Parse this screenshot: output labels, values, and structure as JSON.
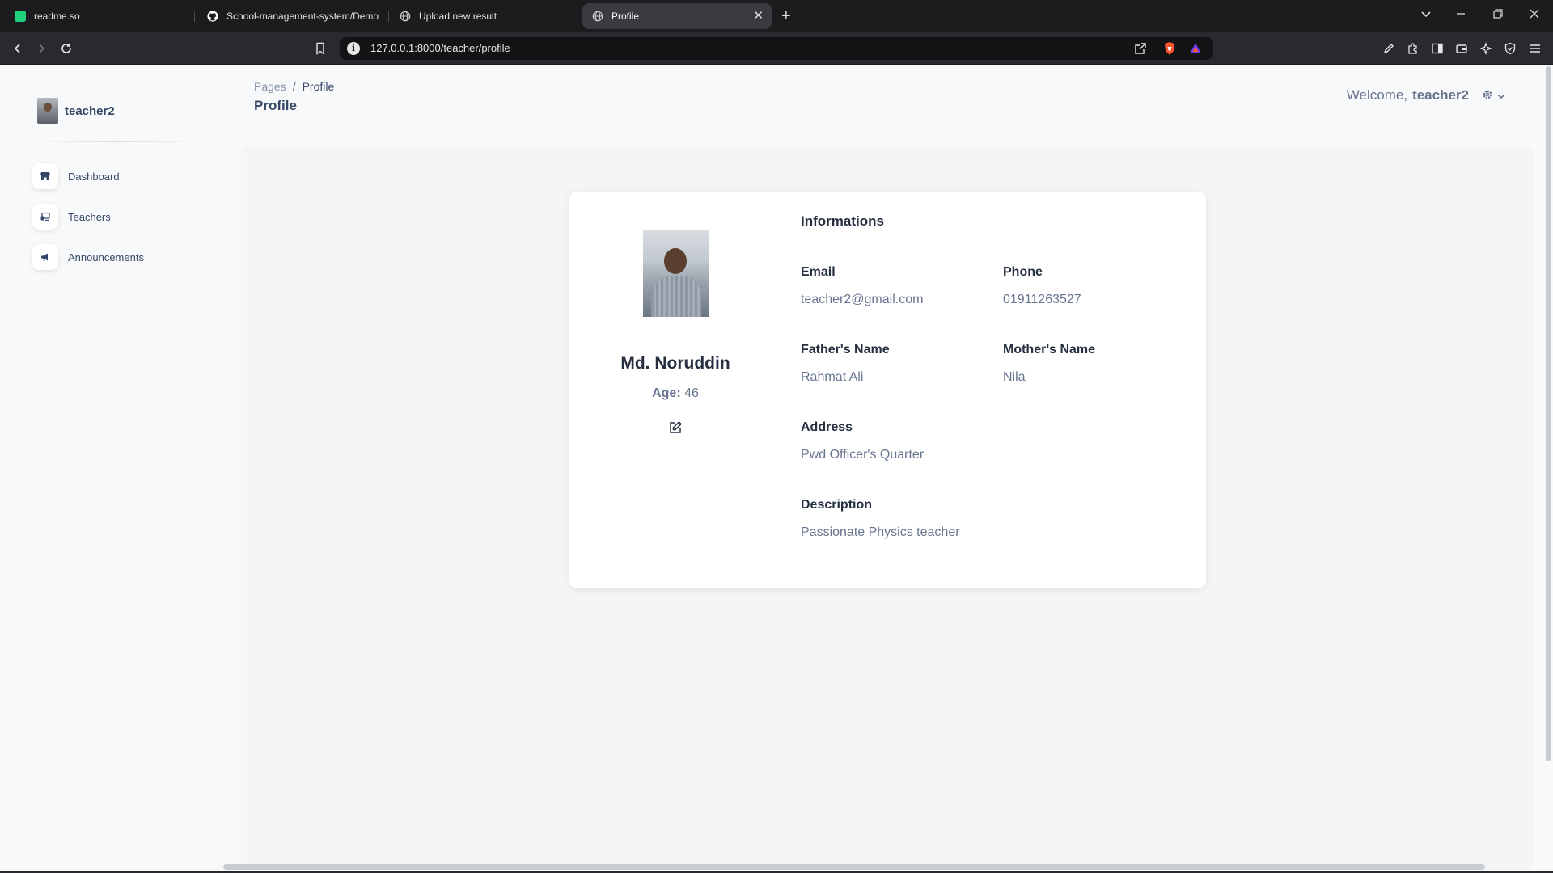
{
  "browser": {
    "tabs": [
      {
        "title": "readme.so",
        "favicon_color": "#1fd17c"
      },
      {
        "title": "School-management-system/Demo",
        "favicon_color": "#ffffff"
      },
      {
        "title": "Upload new result",
        "favicon_color": "#cccccc"
      },
      {
        "title": "Profile",
        "favicon_color": "#cccccc",
        "active": true
      }
    ],
    "url": "127.0.0.1:8000/teacher/profile",
    "icons": [
      "back-icon",
      "forward-icon",
      "reload-icon",
      "bookmark-icon",
      "site-info-icon",
      "share-icon",
      "brave-shield-icon",
      "brave-rewards-icon",
      "pen-icon",
      "extensions-icon",
      "sidebar-icon",
      "wallet-icon",
      "leo-icon",
      "vpn-icon",
      "menu-icon"
    ]
  },
  "sidebar": {
    "user": "teacher2",
    "items": [
      {
        "label": "Dashboard",
        "icon": "shop-icon"
      },
      {
        "label": "Teachers",
        "icon": "screen-icon"
      },
      {
        "label": "Announcements",
        "icon": "megaphone-icon"
      }
    ]
  },
  "header": {
    "breadcrumb_root": "Pages",
    "breadcrumb_sep": "/",
    "breadcrumb_current": "Profile",
    "title": "Profile",
    "welcome": "Welcome,",
    "username": "teacher2"
  },
  "profile": {
    "name": "Md. Noruddin",
    "age_label": "Age:",
    "age": "46",
    "info_title": "Informations",
    "fields": {
      "email_label": "Email",
      "email": "teacher2@gmail.com",
      "phone_label": "Phone",
      "phone": "01911263527",
      "father_label": "Father's Name",
      "father": "Rahmat Ali",
      "mother_label": "Mother's Name",
      "mother": "Nila",
      "address_label": "Address",
      "address": "Pwd Officer's Quarter",
      "description_label": "Description",
      "description": "Passionate Physics teacher"
    }
  },
  "colors": {
    "text_dark": "#252f40",
    "text_muted": "#67748e",
    "nav_text": "#344767",
    "page_bg": "#f8f9fa",
    "card_bg": "#ffffff"
  }
}
